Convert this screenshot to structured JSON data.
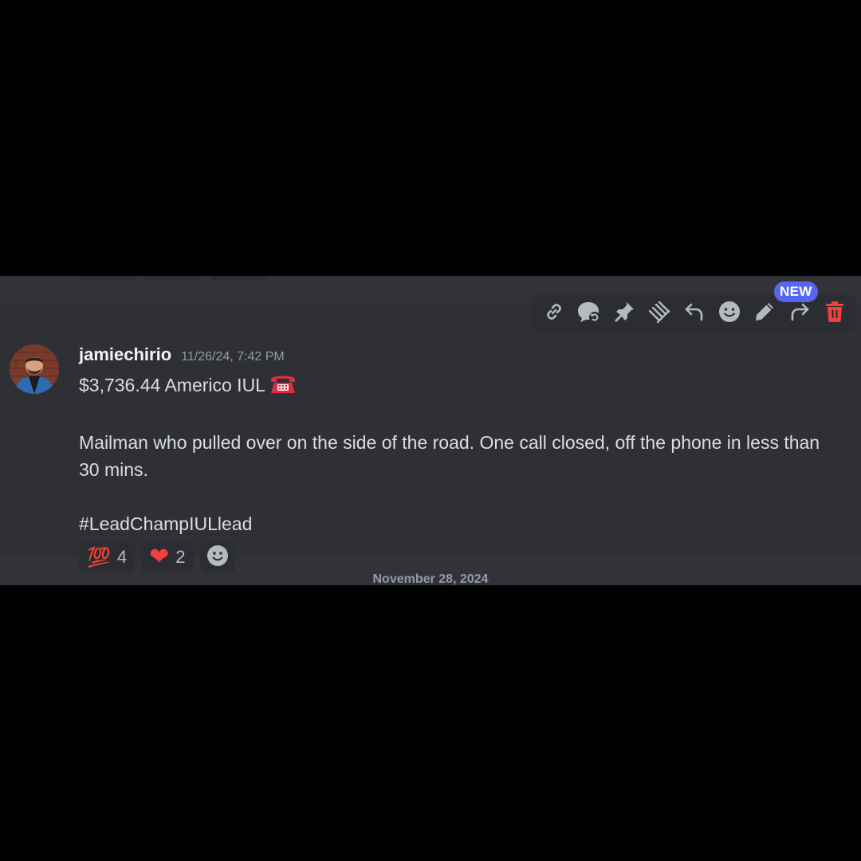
{
  "message": {
    "username": "jamiechirio",
    "timestamp": "11/26/24, 7:42 PM",
    "lines": [
      "$3,736.44 Americo IUL",
      "Mailman who pulled over on the side of the road. One call closed, off the phone in less than 30 mins.",
      "#LeadChampIULlead"
    ],
    "title_emoji": "telephone-emoji"
  },
  "reactions": [
    {
      "emoji": "100-emoji",
      "glyph": "💯",
      "count": "4"
    },
    {
      "emoji": "heart-emoji",
      "glyph": "❤",
      "count": "2"
    }
  ],
  "toolbar": {
    "badge": "NEW",
    "actions": [
      "copy-link-icon",
      "thread-icon",
      "pin-icon",
      "mark-icon",
      "reply-icon",
      "add-reaction-icon",
      "edit-icon",
      "forward-icon",
      "delete-icon"
    ],
    "colors": {
      "icon": "#b5bac1",
      "delete": "#f23f42",
      "badge": "#5865f2"
    }
  },
  "divider": {
    "date": "November 28, 2024"
  },
  "colors": {
    "background": "#313338",
    "hover": "#2e3035",
    "text": "#dbdee1",
    "muted": "#949ba4"
  }
}
